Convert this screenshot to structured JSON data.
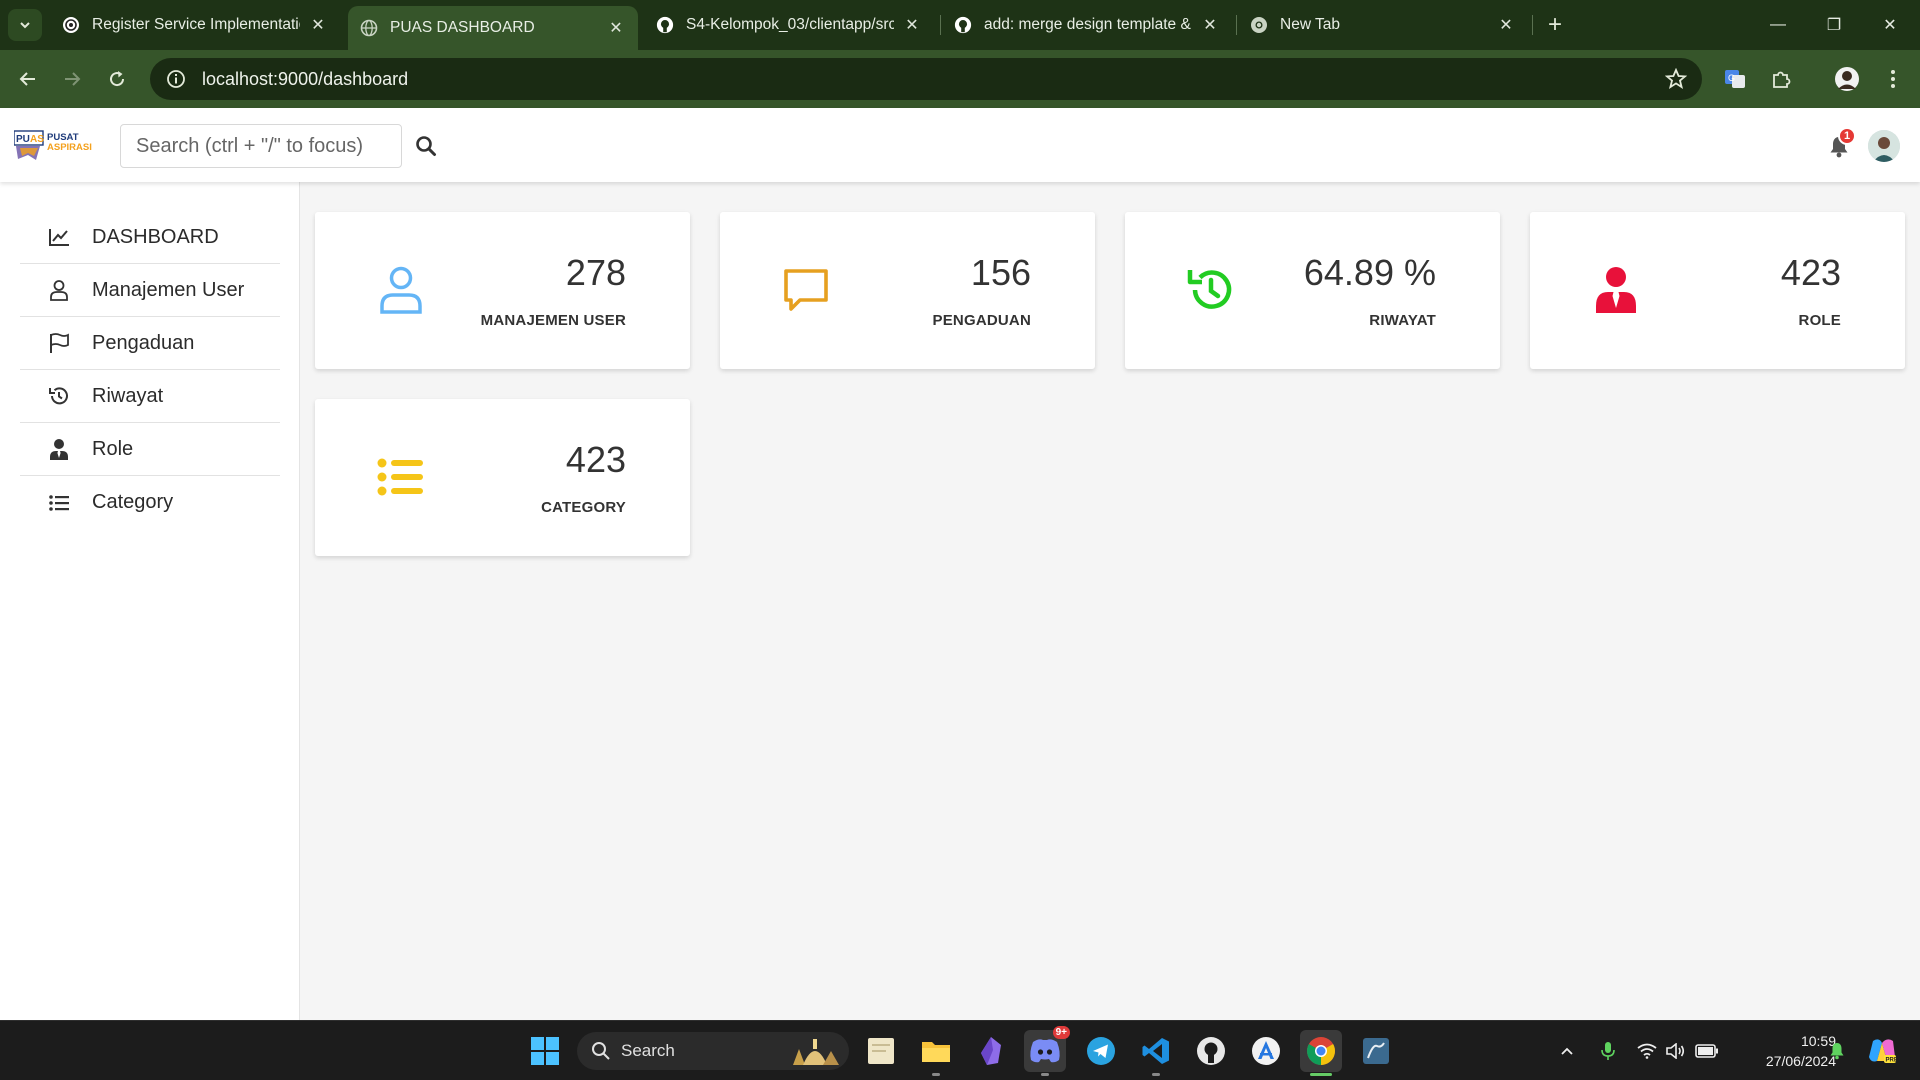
{
  "browser": {
    "tabs": [
      {
        "title": "Register Service Implementatio",
        "icon": "openai-icon",
        "active": false
      },
      {
        "title": "PUAS DASHBOARD",
        "icon": "globe-icon",
        "active": true
      },
      {
        "title": "S4-Kelompok_03/clientapp/src/",
        "icon": "github-icon",
        "active": false
      },
      {
        "title": "add: merge design template & ",
        "icon": "github-icon",
        "active": false
      },
      {
        "title": "New Tab",
        "icon": "chrome-icon",
        "active": false
      }
    ],
    "tab_close_glyph": "✕",
    "new_tab_glyph": "+",
    "url": "localhost:9000/dashboard",
    "window_controls": {
      "minimize": "—",
      "restore": "❐",
      "close": "✕"
    }
  },
  "header": {
    "logo_text": {
      "top": "PUAS",
      "line1": "PUSAT",
      "line2": "ASPIRASI"
    },
    "search_placeholder": "Search (ctrl + \"/\" to focus)",
    "notification_count": "1"
  },
  "sidebar": {
    "items": [
      {
        "label": "DASHBOARD",
        "icon": "chart-line-icon"
      },
      {
        "label": "Manajemen User",
        "icon": "user-icon"
      },
      {
        "label": "Pengaduan",
        "icon": "flag-icon"
      },
      {
        "label": "Riwayat",
        "icon": "history-icon"
      },
      {
        "label": "Role",
        "icon": "user-tie-icon"
      },
      {
        "label": "Category",
        "icon": "list-icon"
      }
    ]
  },
  "cards": [
    {
      "value": "278",
      "label": "MANAJEMEN USER",
      "icon": "user-icon",
      "color": "#64b5f6"
    },
    {
      "value": "156",
      "label": "PENGADUAN",
      "icon": "comment-icon",
      "color": "#e6a020"
    },
    {
      "value": "64.89 %",
      "label": "RIWAYAT",
      "icon": "history-icon",
      "color": "#22cc22"
    },
    {
      "value": "423",
      "label": "ROLE",
      "icon": "user-tie-icon",
      "color": "#e8113a"
    },
    {
      "value": "423",
      "label": "CATEGORY",
      "icon": "list-icon",
      "color": "#f5c518"
    }
  ],
  "taskbar": {
    "search_label": "Search",
    "discord_badge": "9+",
    "clock_time": "10:59",
    "clock_date": "27/06/2024"
  }
}
